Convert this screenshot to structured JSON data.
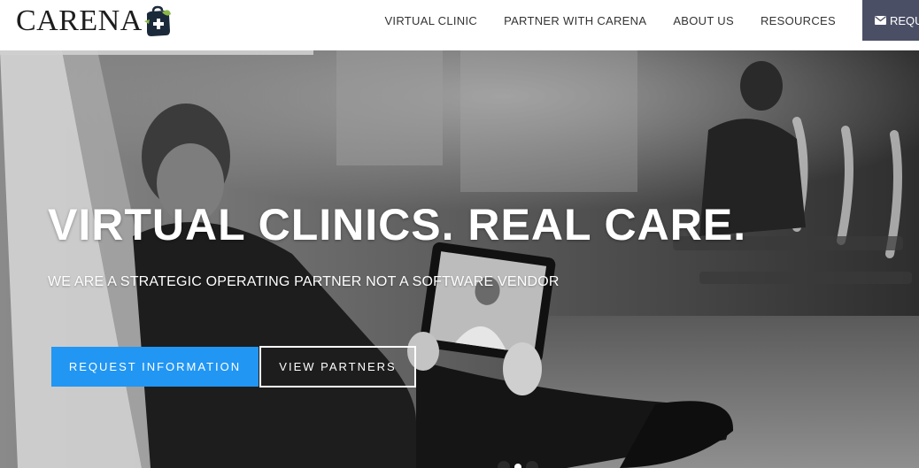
{
  "brand": {
    "name": "CARENA",
    "mark_color": "#8cb84a"
  },
  "nav": {
    "items": [
      {
        "label": "VIRTUAL CLINIC"
      },
      {
        "label": "PARTNER WITH CARENA"
      },
      {
        "label": "ABOUT US"
      },
      {
        "label": "RESOURCES"
      }
    ],
    "cta": {
      "label": "REQU",
      "icon": "envelope-icon"
    }
  },
  "hero": {
    "title": "VIRTUAL CLINICS. REAL CARE.",
    "subtitle": "WE ARE A STRATEGIC OPERATING PARTNER NOT A SOFTWARE VENDOR",
    "primary_button": "REQUEST INFORMATION",
    "secondary_button": "VIEW PARTNERS",
    "slide_count": 3,
    "active_slide": 2
  },
  "colors": {
    "accent_blue": "#2196f3",
    "cta_bg": "#4a4f66",
    "header_bg": "#ffffff"
  }
}
